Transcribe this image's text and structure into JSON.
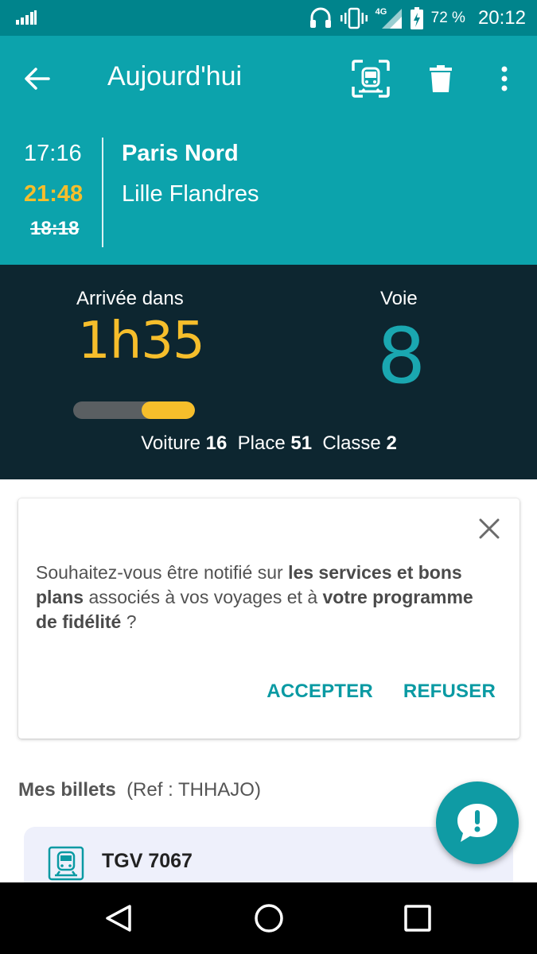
{
  "status_bar": {
    "network_type": "4G",
    "battery": "72 %",
    "time": "20:12",
    "icons": [
      "signal-icon",
      "headset-icon",
      "vibrate-icon",
      "mobile-network-icon",
      "battery-charging-icon"
    ]
  },
  "app_bar": {
    "title": "Aujourd'hui",
    "icons": [
      "back-arrow-icon",
      "scan-train-icon",
      "trash-icon",
      "more-vert-icon"
    ]
  },
  "trip": {
    "departure_time": "17:16",
    "new_arrival_time": "21:48",
    "old_arrival_time": "18:18",
    "from_station": "Paris Nord",
    "to_station": "Lille Flandres"
  },
  "info_panel": {
    "arrival_label": "Arrivée dans",
    "arrival_value": "1h35",
    "platform_label": "Voie",
    "platform_value": "8",
    "progress_fraction": 0.56,
    "coach_label": "Voiture",
    "coach_value": "16",
    "seat_label": "Place",
    "seat_value": "51",
    "class_label": "Classe",
    "class_value": "2"
  },
  "notification_card": {
    "text_1": "Souhaitez-vous être notifié sur ",
    "text_bold_1": "les services et bons plans",
    "text_2": " associés à vos voyages et à ",
    "text_bold_2": "votre programme de fidélité",
    "text_3": " ?",
    "accept_label": "ACCEPTER",
    "refuse_label": "REFUSER"
  },
  "tickets": {
    "heading": "Mes billets",
    "reference": "(Ref : THHAJO)",
    "items": [
      {
        "title": "TGV 7067",
        "icon": "train-icon"
      }
    ]
  },
  "fab": {
    "icon": "feedback-alert-icon"
  },
  "colors": {
    "status_bar": "#00848c",
    "app_bar": "#0ca3ac",
    "info_panel": "#0d2630",
    "accent_yellow": "#f6be2b",
    "platform_teal": "#1aa7b0",
    "button_teal": "#0a9aa3"
  },
  "nav_bar": {
    "icons": [
      "nav-back-icon",
      "nav-home-icon",
      "nav-recents-icon"
    ]
  }
}
